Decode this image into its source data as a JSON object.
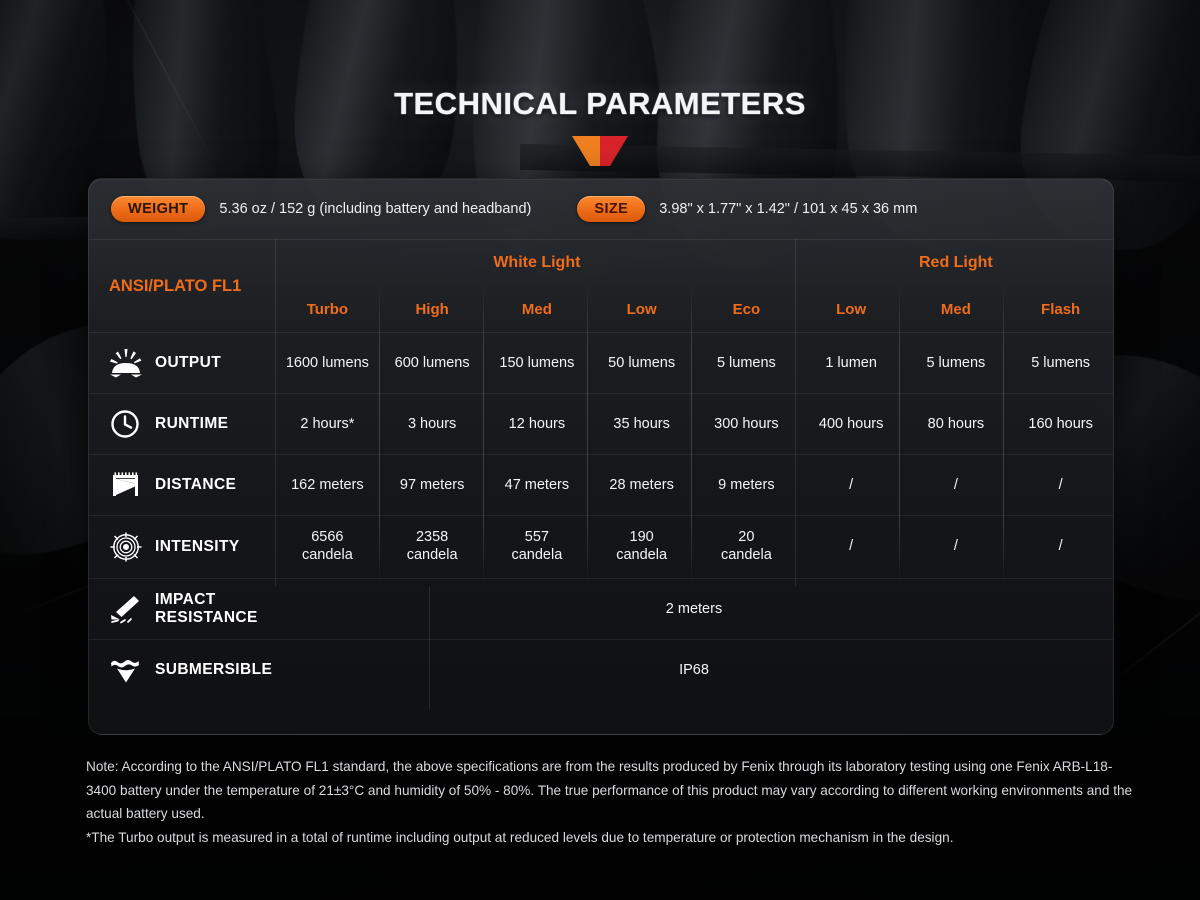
{
  "header": {
    "title": "TECHNICAL PARAMETERS",
    "chevron_icon": "chevron-down-icon",
    "chevron_left_color": "#ef7f1f",
    "chevron_right_color": "#d8232a"
  },
  "accent": {
    "orange": "#ef6c1a",
    "pill_gradient_top": "#fb8a33",
    "pill_gradient_bottom": "#da5a0d",
    "text": "#f2f4f6"
  },
  "specs": {
    "weight_label": "WEIGHT",
    "weight_value": "5.36 oz / 152 g (including battery and headband)",
    "size_label": "SIZE",
    "size_value": "3.98\" x 1.77\" x 1.42\" / 101 x 45 x 36 mm"
  },
  "table": {
    "standard_label": "ANSI/PLATO FL1",
    "groups": [
      {
        "name": "White Light",
        "span": 5
      },
      {
        "name": "Red Light",
        "span": 3
      }
    ],
    "modes": [
      "Turbo",
      "High",
      "Med",
      "Low",
      "Eco",
      "Low",
      "Med",
      "Flash"
    ],
    "rows": [
      {
        "label": "OUTPUT",
        "icon": "sunburst-icon",
        "values": [
          "1600 lumens",
          "600 lumens",
          "150 lumens",
          "50 lumens",
          "5 lumens",
          "1 lumen",
          "5 lumens",
          "5 lumens"
        ]
      },
      {
        "label": "RUNTIME",
        "icon": "clock-icon",
        "values": [
          "2 hours*",
          "3 hours",
          "12 hours",
          "35 hours",
          "300 hours",
          "400 hours",
          "80 hours",
          "160 hours"
        ]
      },
      {
        "label": "DISTANCE",
        "icon": "beam-distance-icon",
        "values": [
          "162 meters",
          "97 meters",
          "47 meters",
          "28 meters",
          "9 meters",
          "/",
          "/",
          "/"
        ]
      },
      {
        "label": "INTENSITY",
        "icon": "target-intensity-icon",
        "values": [
          "6566\ncandela",
          "2358\ncandela",
          "557\ncandela",
          "190\ncandela",
          "20\ncandela",
          "/",
          "/",
          "/"
        ]
      }
    ],
    "full_rows": [
      {
        "label": "IMPACT RESISTANCE",
        "icon": "impact-drop-icon",
        "value": "2 meters"
      },
      {
        "label": "SUBMERSIBLE",
        "icon": "water-drop-icon",
        "value": "IP68"
      }
    ]
  },
  "note": {
    "line1": "Note: According to the ANSI/PLATO FL1 standard, the above specifications are from the results produced by Fenix through its laboratory testing using one Fenix ARB-L18-3400 battery under the temperature of 21±3°C and humidity of 50% - 80%. The true performance of this product may vary according to different working environments and the actual battery used.",
    "line2": "*The Turbo output is measured in a total of runtime including output at reduced levels due to temperature or protection mechanism in the design."
  }
}
